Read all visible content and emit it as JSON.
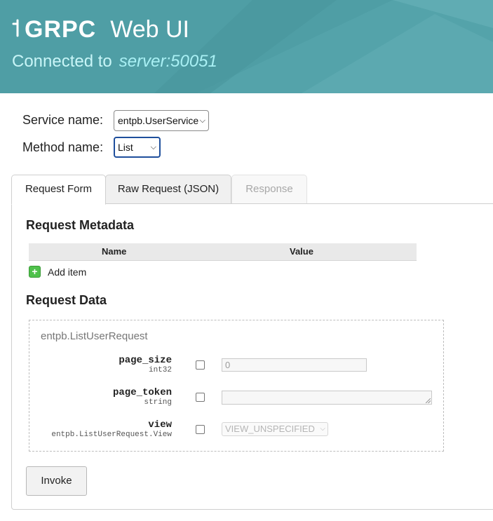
{
  "header": {
    "logo_text": "GRPC",
    "title": "Web UI",
    "connected_prefix": "Connected to",
    "server": "server:50051"
  },
  "selectors": {
    "service_label": "Service name:",
    "service_value": "entpb.UserService",
    "method_label": "Method name:",
    "method_value": "List"
  },
  "tabs": [
    {
      "label": "Request Form",
      "state": "active"
    },
    {
      "label": "Raw Request (JSON)",
      "state": "normal"
    },
    {
      "label": "Response",
      "state": "disabled"
    }
  ],
  "metadata": {
    "heading": "Request Metadata",
    "columns": [
      "Name",
      "Value"
    ],
    "add_item_label": "Add item"
  },
  "request_data": {
    "heading": "Request Data",
    "message_type": "entpb.ListUserRequest",
    "fields": [
      {
        "name": "page_size",
        "type": "int32",
        "value": "0"
      },
      {
        "name": "page_token",
        "type": "string",
        "value": ""
      },
      {
        "name": "view",
        "type": "entpb.ListUserRequest.View",
        "value": "VIEW_UNSPECIFIED"
      }
    ]
  },
  "invoke_label": "Invoke",
  "colors": {
    "header_bg": "#4f9ea5",
    "server_text": "#a9f0f4",
    "add_button": "#4fc14b",
    "focus_border": "#1f4f9c"
  }
}
